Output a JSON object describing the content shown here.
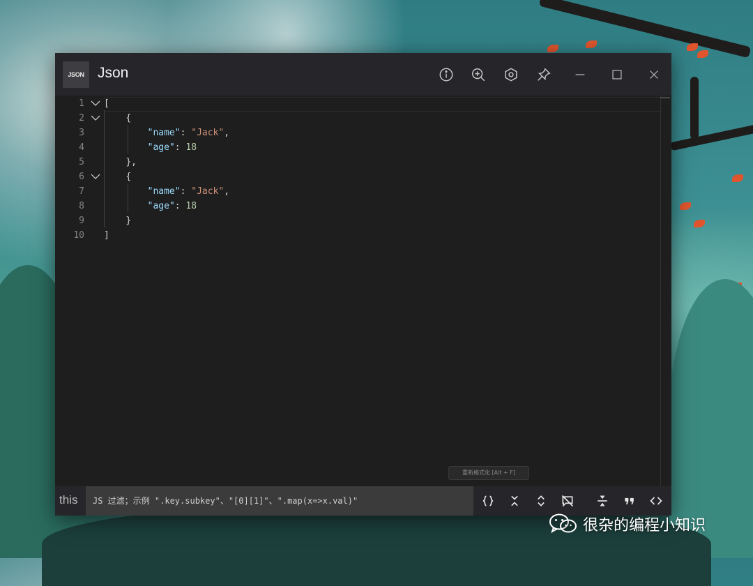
{
  "app": {
    "logo_text": "JSON",
    "title": "Json"
  },
  "toolbar": {
    "icons": [
      "info-icon",
      "zoom-in-icon",
      "settings-hex-icon",
      "pin-icon",
      "minimize-icon",
      "maximize-icon",
      "close-icon"
    ]
  },
  "editor": {
    "lines": [
      {
        "num": "1",
        "foldable": true
      },
      {
        "num": "2",
        "foldable": true
      },
      {
        "num": "3",
        "foldable": false,
        "key": "\"name\"",
        "value": "\"Jack\"",
        "value_type": "string",
        "trail": ","
      },
      {
        "num": "4",
        "foldable": false,
        "key": "\"age\"",
        "value": "18",
        "value_type": "number",
        "trail": ""
      },
      {
        "num": "5",
        "foldable": false
      },
      {
        "num": "6",
        "foldable": true
      },
      {
        "num": "7",
        "foldable": false,
        "key": "\"name\"",
        "value": "\"Jack\"",
        "value_type": "string",
        "trail": ","
      },
      {
        "num": "8",
        "foldable": false,
        "key": "\"age\"",
        "value": "18",
        "value_type": "number",
        "trail": ""
      },
      {
        "num": "9",
        "foldable": false
      },
      {
        "num": "10",
        "foldable": false
      }
    ],
    "brackets": {
      "open_array": "[",
      "open_object": "{",
      "close_object_comma": "},",
      "close_object": "}",
      "close_array": "]",
      "colon": ": "
    },
    "hint": "重新格式化 [Alt + F]"
  },
  "bottom": {
    "scope_label": "this",
    "filter_placeholder": "JS 过滤；示例 \".key.subkey\"、\"[0][1]\"、\".map(x=>x.val)\"",
    "icons": [
      "braces-icon",
      "collapse-all-icon",
      "expand-all-icon",
      "hide-comment-icon",
      "compress-lines-icon",
      "quote-icon",
      "code-icon"
    ]
  },
  "watermark": {
    "text": "很杂的编程小知识"
  },
  "colors": {
    "key": "#9cdcfe",
    "string": "#ce9178",
    "number": "#b5cea8",
    "punct": "#d4d4d4",
    "line_number": "#858585"
  }
}
